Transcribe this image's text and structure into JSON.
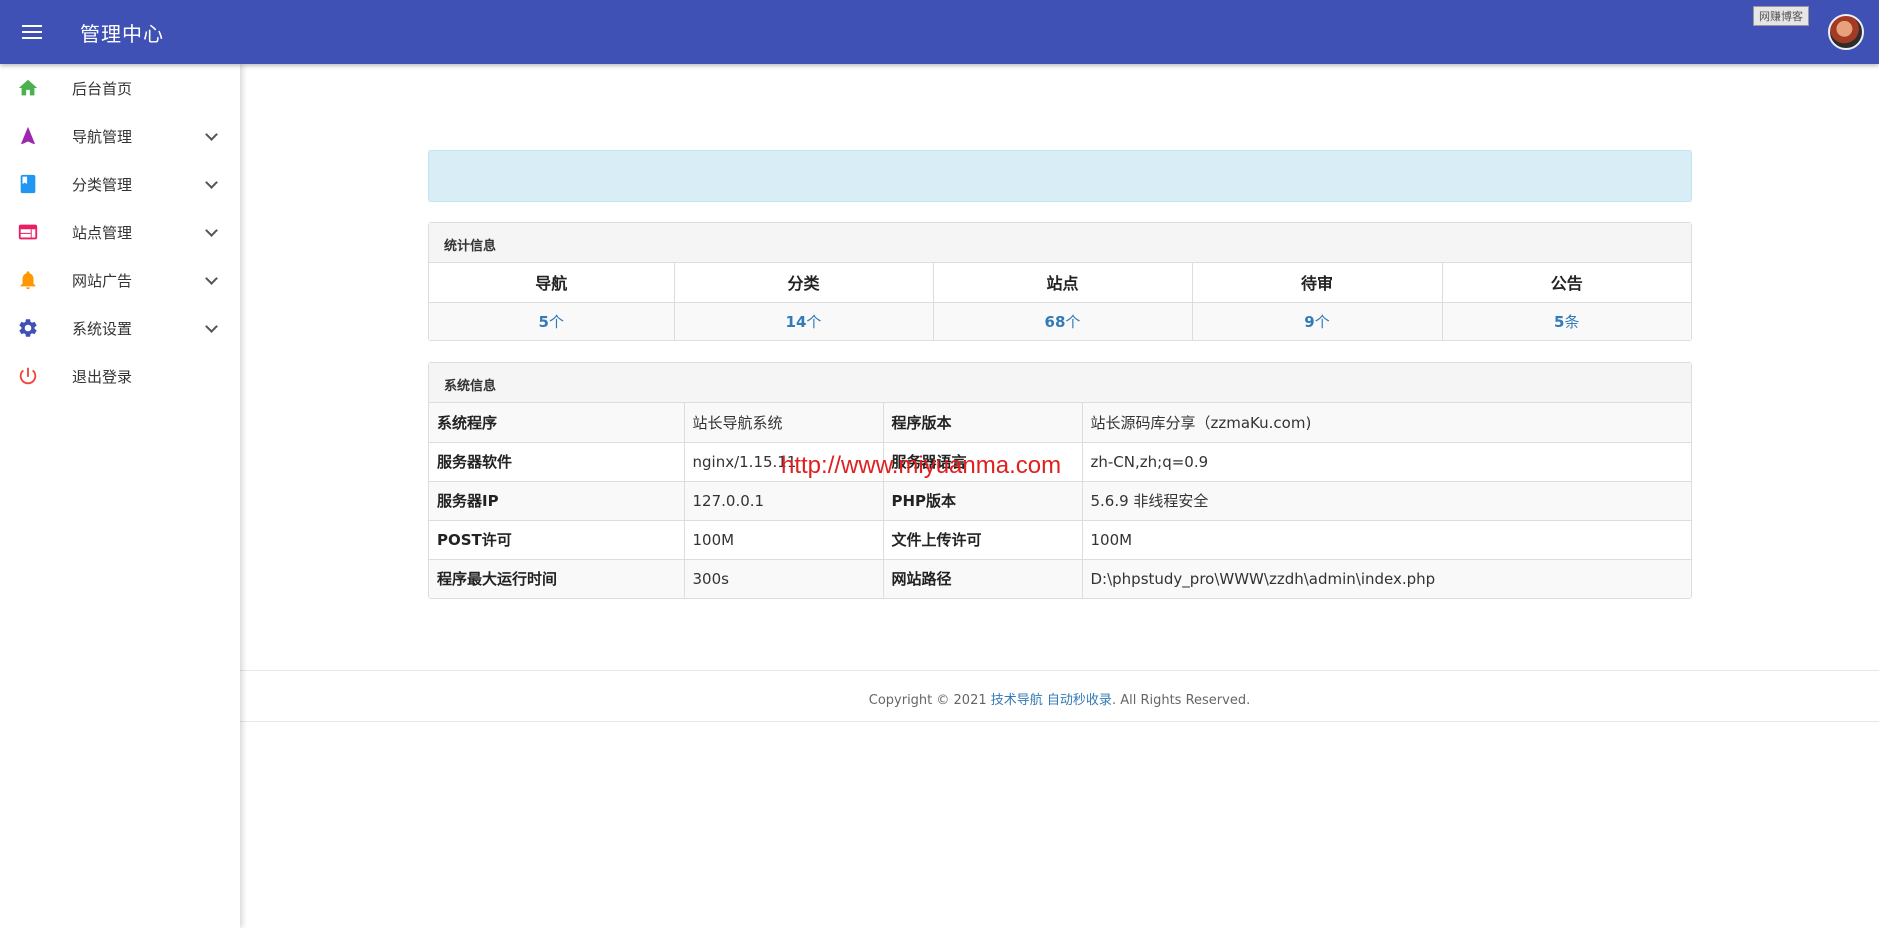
{
  "header": {
    "title": "管理中心",
    "user_tag": "网赚博客"
  },
  "sidebar": {
    "items": [
      {
        "label": "后台首页",
        "icon": "home-icon",
        "color": "#4caf50"
      },
      {
        "label": "导航管理",
        "icon": "navigation-icon",
        "color": "#9c27b0"
      },
      {
        "label": "分类管理",
        "icon": "book-icon",
        "color": "#2196f3"
      },
      {
        "label": "站点管理",
        "icon": "web-icon",
        "color": "#e91e63"
      },
      {
        "label": "网站广告",
        "icon": "bell-icon",
        "color": "#ff9800"
      },
      {
        "label": "系统设置",
        "icon": "gear-icon",
        "color": "#3f51b5"
      },
      {
        "label": "退出登录",
        "icon": "power-icon",
        "color": "#f44336"
      }
    ]
  },
  "stats": {
    "title": "统计信息",
    "columns": [
      {
        "label": "导航",
        "value": "5",
        "unit": "个"
      },
      {
        "label": "分类",
        "value": "14",
        "unit": "个"
      },
      {
        "label": "站点",
        "value": "68",
        "unit": "个"
      },
      {
        "label": "待审",
        "value": "9",
        "unit": "个"
      },
      {
        "label": "公告",
        "value": "5",
        "unit": "条"
      }
    ]
  },
  "system": {
    "title": "系统信息",
    "rows": [
      {
        "k1": "系统程序",
        "v1": "站长导航系统",
        "k2": "程序版本",
        "v2": "站长源码库分享（zzmaKu.com)"
      },
      {
        "k1": "服务器软件",
        "v1": "nginx/1.15.11",
        "k2": "服务器语言",
        "v2": "zh-CN,zh;q=0.9"
      },
      {
        "k1": "服务器IP",
        "v1": "127.0.0.1",
        "k2": "PHP版本",
        "v2": "5.6.9 非线程安全"
      },
      {
        "k1": "POST许可",
        "v1": "100M",
        "k2": "文件上传许可",
        "v2": "100M"
      },
      {
        "k1": "程序最大运行时间",
        "v1": "300s",
        "k2": "网站路径",
        "v2": "D:\\phpstudy_pro\\WWW\\zzdh\\admin\\index.php"
      }
    ]
  },
  "watermark": "http://www.miyuanma.com",
  "footer": {
    "prefix": "Copyright © 2021 ",
    "link1": "技术导航",
    "link2": "自动秒收录",
    "suffix": ". All Rights Reserved."
  }
}
